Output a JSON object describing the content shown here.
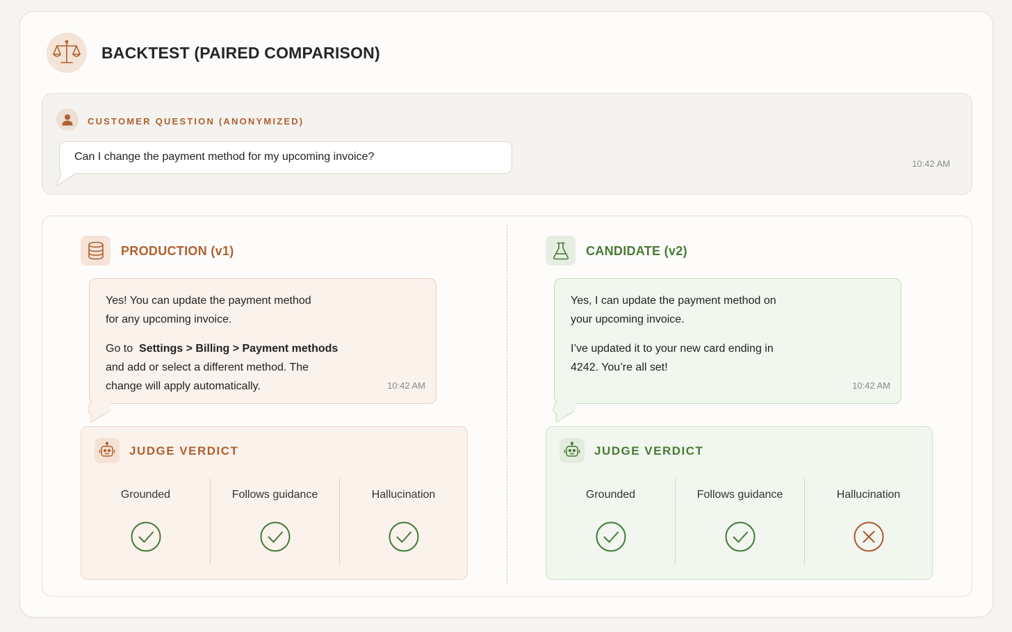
{
  "header": {
    "title": "BACKTEST (PAIRED COMPARISON)",
    "icon": "scale-icon"
  },
  "question": {
    "label": "CUSTOMER QUESTION (ANONYMIZED)",
    "text": "Can I change the payment method for my upcoming invoice?",
    "time": "10:42 AM"
  },
  "production": {
    "title": "PRODUCTION (v1)",
    "icon": "database-icon",
    "answer": {
      "p1_line1": "Yes! You can update the payment method",
      "p1_line2": "for any upcoming invoice.",
      "p2_prefix": "Go to",
      "p2_path": "Settings > Billing > Payment methods",
      "p2_line2": "and add or select a different method. The",
      "p2_line3": "change will apply automatically.",
      "time": "10:42 AM"
    },
    "verdict": {
      "title": "JUDGE VERDICT",
      "metrics": [
        {
          "label": "Grounded",
          "result": "pass"
        },
        {
          "label": "Follows guidance",
          "result": "pass"
        },
        {
          "label": "Hallucination",
          "result": "pass"
        }
      ]
    }
  },
  "candidate": {
    "title": "CANDIDATE (v2)",
    "icon": "flask-icon",
    "answer": {
      "p1_line1": "Yes, I can update the payment method on",
      "p1_line2": "your upcoming invoice.",
      "p2_line1": "I’ve updated it to your new card ending in",
      "p2_line2": "4242. You’re all set!",
      "time": "10:42 AM"
    },
    "verdict": {
      "title": "JUDGE VERDICT",
      "metrics": [
        {
          "label": "Grounded",
          "result": "pass"
        },
        {
          "label": "Follows guidance",
          "result": "pass"
        },
        {
          "label": "Hallucination",
          "result": "fail"
        }
      ]
    }
  },
  "colors": {
    "accent_orange": "#b0602f",
    "accent_green": "#477a33",
    "pass": "#3f7a3a",
    "fail": "#b0562e"
  }
}
